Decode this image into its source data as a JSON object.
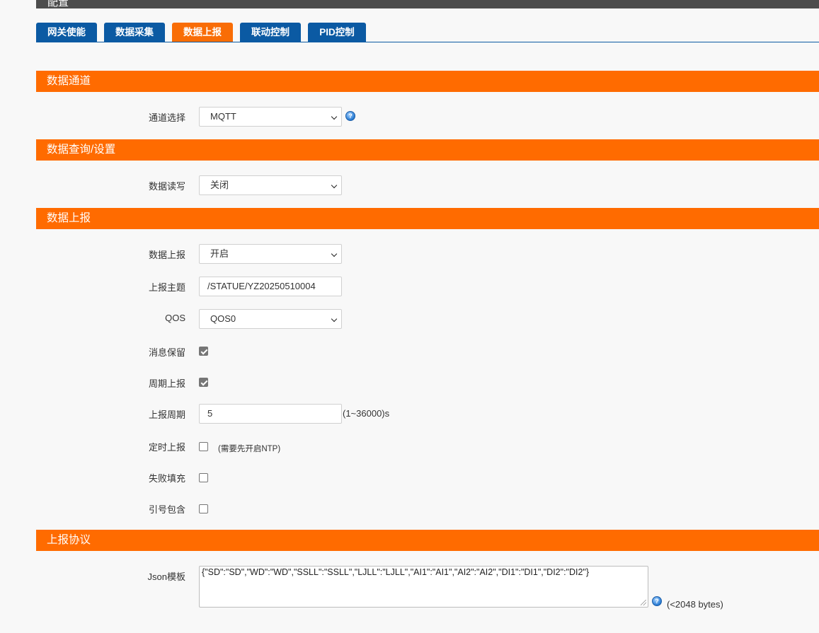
{
  "header": {
    "title": "配置"
  },
  "tabs": [
    {
      "label": "网关使能",
      "active": false
    },
    {
      "label": "数据采集",
      "active": false
    },
    {
      "label": "数据上报",
      "active": true
    },
    {
      "label": "联动控制",
      "active": false
    },
    {
      "label": "PID控制",
      "active": false
    }
  ],
  "sections": {
    "channel": {
      "title": "数据通道",
      "channel_select": {
        "label": "通道选择",
        "value": "MQTT"
      }
    },
    "query": {
      "title": "数据查询/设置",
      "read_write": {
        "label": "数据读写",
        "value": "关闭"
      }
    },
    "report": {
      "title": "数据上报",
      "report_enable": {
        "label": "数据上报",
        "value": "开启"
      },
      "topic": {
        "label": "上报主题",
        "value": "/STATUE/YZ20250510004"
      },
      "qos": {
        "label": "QOS",
        "value": "QOS0"
      },
      "retain": {
        "label": "消息保留",
        "checked": true
      },
      "periodic": {
        "label": "周期上报",
        "checked": true
      },
      "period": {
        "label": "上报周期",
        "value": "5",
        "unit": "(1~36000)s"
      },
      "timed": {
        "label": "定时上报",
        "checked": false,
        "note": "(需要先开启NTP)"
      },
      "fail_fill": {
        "label": "失败填充",
        "checked": false
      },
      "quote": {
        "label": "引号包含",
        "checked": false
      }
    },
    "protocol": {
      "title": "上报协议",
      "json_template": {
        "label": "Json模板",
        "value": "{\"SD\":\"SD\",\"WD\":\"WD\",\"SSLL\":\"SSLL\",\"LJLL\":\"LJLL\",\"AI1\":\"AI1\",\"AI2\":\"AI2\",\"DI1\":\"DI1\",\"DI2\":\"DI2\"}",
        "limit": "(<2048 bytes)"
      }
    }
  },
  "colors": {
    "accent": "#ff6b00",
    "tab_blue": "#0b5aa3"
  },
  "icons": {
    "help": "help-question-icon"
  }
}
